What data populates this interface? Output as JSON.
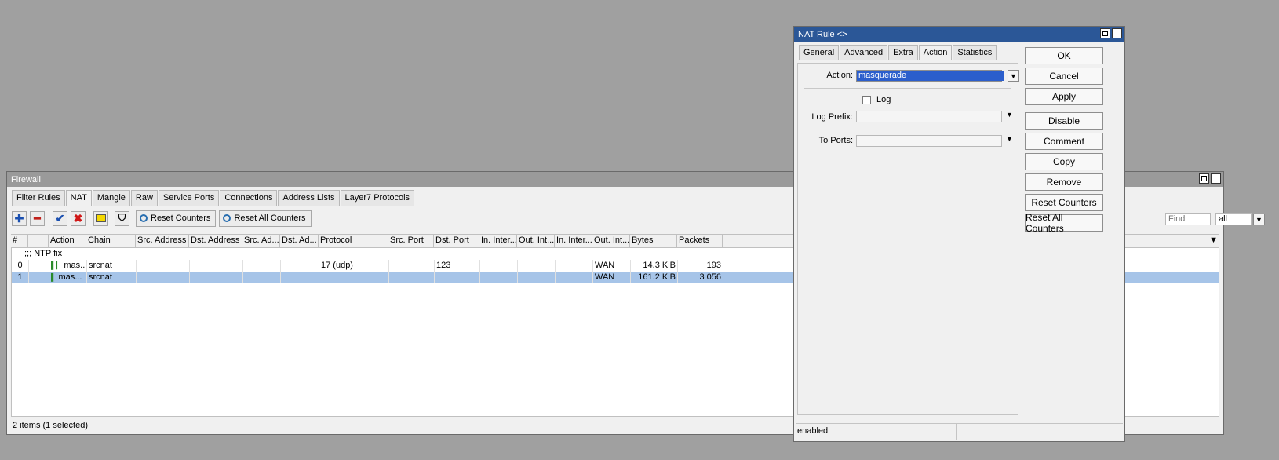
{
  "firewall": {
    "title": "Firewall",
    "tabs": [
      "Filter Rules",
      "NAT",
      "Mangle",
      "Raw",
      "Service Ports",
      "Connections",
      "Address Lists",
      "Layer7 Protocols"
    ],
    "toolbar": {
      "reset_counters": "Reset Counters",
      "reset_all_counters": "Reset All Counters",
      "find_placeholder": "Find",
      "filter_value": "all"
    },
    "columns": [
      "#",
      "",
      "Action",
      "Chain",
      "Src. Address",
      "Dst. Address",
      "Src. Ad...",
      "Dst. Ad...",
      "Protocol",
      "Src. Port",
      "Dst. Port",
      "In. Inter...",
      "Out. Int...",
      "In. Inter...",
      "Out. Int...",
      "Bytes",
      "Packets"
    ],
    "comment": ";;; NTP fix",
    "rows": [
      {
        "num": "0",
        "action": "mas...",
        "chain": "srcnat",
        "protocol": "17 (udp)",
        "dst_port": "123",
        "out_int": "WAN",
        "bytes": "14.3 KiB",
        "packets": "193"
      },
      {
        "num": "1",
        "action": "mas...",
        "chain": "srcnat",
        "protocol": "",
        "dst_port": "",
        "out_int": "WAN",
        "bytes": "161.2 KiB",
        "packets": "3 056"
      }
    ],
    "status": "2 items (1 selected)"
  },
  "natrule": {
    "title": "NAT Rule <>",
    "tabs": [
      "General",
      "Advanced",
      "Extra",
      "Action",
      "Statistics"
    ],
    "action_label": "Action:",
    "action_value": "masquerade",
    "log_label": "Log",
    "log_prefix_label": "Log Prefix:",
    "to_ports_label": "To Ports:",
    "status": "enabled",
    "buttons": [
      "OK",
      "Cancel",
      "Apply",
      "Disable",
      "Comment",
      "Copy",
      "Remove",
      "Reset Counters",
      "Reset All Counters"
    ]
  }
}
